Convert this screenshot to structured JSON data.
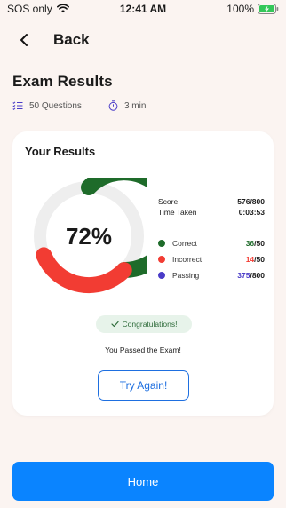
{
  "status_bar": {
    "carrier": "SOS only",
    "time": "12:41 AM",
    "battery": "100%"
  },
  "header": {
    "back_label": "Back"
  },
  "page_title": "Exam Results",
  "meta": {
    "questions": "50 Questions",
    "duration": "3 min"
  },
  "card": {
    "title": "Your Results",
    "percent_label": "72%",
    "score_label": "Score",
    "score_value": "576/800",
    "time_label": "Time Taken",
    "time_value": "0:03:53",
    "legend": [
      {
        "name": "Correct",
        "value": "36",
        "total": "/50",
        "color": "#1e6b2a"
      },
      {
        "name": "Incorrect",
        "value": "14",
        "total": "/50",
        "color": "#f23c33"
      },
      {
        "name": "Passing",
        "value": "375",
        "total": "/800",
        "color": "#4a3cc8"
      }
    ],
    "congrats": "Congratulations!",
    "passed_text": "You Passed the Exam!",
    "try_again": "Try Again!"
  },
  "home_button": "Home",
  "colors": {
    "correct": "#1e6b2a",
    "incorrect": "#f23c33",
    "passing": "#4a3cc8",
    "track": "#eeeeee",
    "primary": "#0a84ff"
  },
  "icons": {
    "signal": "wifi-icon",
    "battery": "battery-charging-icon",
    "back": "chevron-left-icon",
    "questions": "list-icon",
    "duration": "timer-icon",
    "congrats": "check-icon"
  }
}
